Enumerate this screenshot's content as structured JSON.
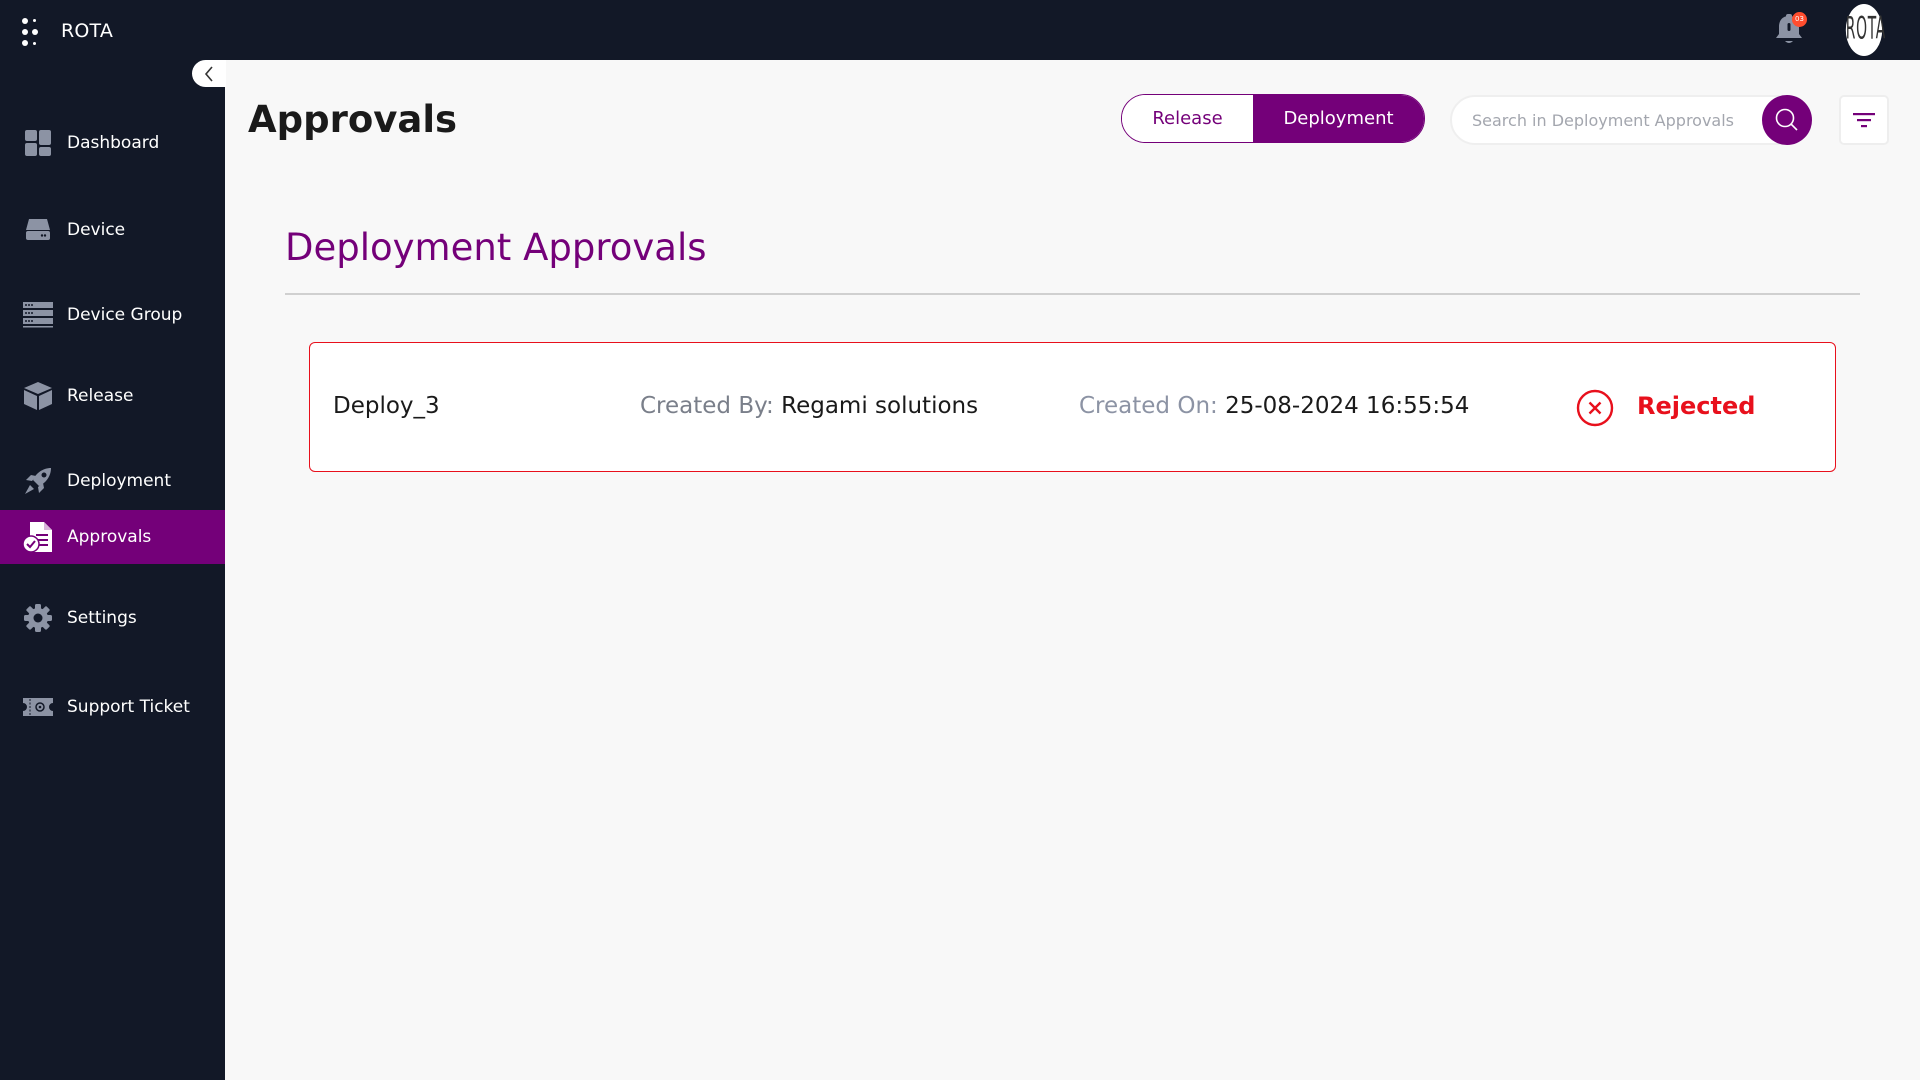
{
  "app": {
    "brand": "ROTA",
    "notification_count": "03",
    "avatar_text": "ROTA"
  },
  "sidebar": {
    "items": [
      {
        "label": "Dashboard",
        "icon": "dashboard-icon"
      },
      {
        "label": "Device",
        "icon": "device-icon"
      },
      {
        "label": "Device Group",
        "icon": "device-group-icon"
      },
      {
        "label": "Release",
        "icon": "release-box-icon"
      },
      {
        "label": "Deployment",
        "icon": "rocket-icon"
      },
      {
        "label": "Approvals",
        "icon": "approvals-document-icon",
        "active": true
      },
      {
        "label": "Settings",
        "icon": "gear-icon"
      },
      {
        "label": "Support Ticket",
        "icon": "ticket-icon"
      }
    ]
  },
  "header": {
    "title": "Approvals",
    "toggle": {
      "options": [
        "Release",
        "Deployment"
      ],
      "selected": "Deployment"
    },
    "search": {
      "placeholder": "Search in Deployment Approvals",
      "value": ""
    }
  },
  "main": {
    "section_title": "Deployment Approvals",
    "approvals": [
      {
        "name": "Deploy_3",
        "created_by_label": "Created By:",
        "created_by": "Regami solutions",
        "created_on_label": "Created On:",
        "created_on": "25-08-2024 16:55:54",
        "status": "Rejected"
      }
    ]
  },
  "colors": {
    "topbar": "#121827",
    "accent": "#740079",
    "rejected": "#e8101c",
    "badge": "#ff4d2e"
  }
}
